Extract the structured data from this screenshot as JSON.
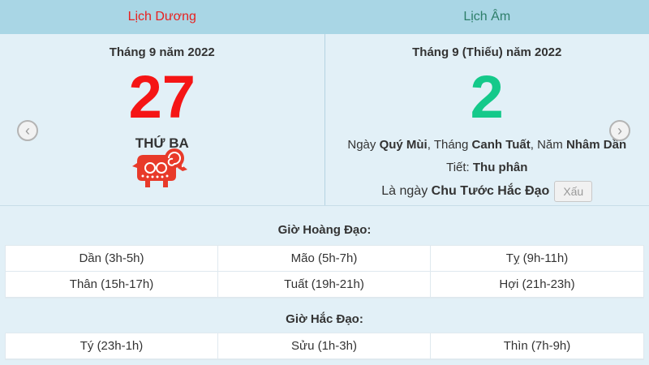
{
  "header": {
    "solar_label": "Lịch Dương",
    "lunar_label": "Lịch Âm"
  },
  "solar": {
    "month_year": "Tháng 9 năm 2022",
    "day": "27",
    "weekday": "THỨ BA"
  },
  "lunar": {
    "month_year": "Tháng 9 (Thiếu) năm 2022",
    "day": "2",
    "ganzhi": {
      "day_prefix": "Ngày",
      "day": "Quý Mùi",
      "month_prefix": "Tháng",
      "month": "Canh Tuất",
      "year_prefix": "Năm",
      "year": "Nhâm Dần"
    },
    "solar_term_prefix": "Tiết:",
    "solar_term": "Thu phân",
    "day_type_prefix": "Là ngày",
    "day_type": "Chu Tước Hắc Đạo",
    "day_rating": "Xấu"
  },
  "nav": {
    "prev": "‹",
    "next": "›"
  },
  "gio_hoang_dao": {
    "title": "Giờ Hoàng Đạo:",
    "hours": [
      "Dần (3h-5h)",
      "Mão (5h-7h)",
      "Tỵ (9h-11h)",
      "Thân (15h-17h)",
      "Tuất (19h-21h)",
      "Hợi (21h-23h)"
    ]
  },
  "gio_hac_dao": {
    "title": "Giờ Hắc Đạo:",
    "hours": [
      "Tý (23h-1h)",
      "Sửu (1h-3h)",
      "Thìn (7h-9h)"
    ]
  },
  "colors": {
    "header_bg": "#a9d6e5",
    "solar_red": "#f51515",
    "lunar_green": "#14c98a",
    "page_bg": "#e2f0f7"
  }
}
